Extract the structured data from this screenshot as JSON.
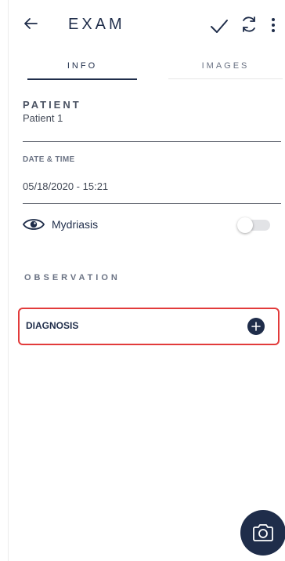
{
  "app_bar": {
    "title": "EXAM",
    "back_icon": "arrow-left-icon",
    "actions": [
      "check-icon",
      "sync-icon",
      "more-vert-icon"
    ]
  },
  "tabs": [
    {
      "label": "INFO",
      "active": true
    },
    {
      "label": "IMAGES",
      "active": false
    }
  ],
  "patient": {
    "label": "PATIENT",
    "value": "Patient 1"
  },
  "date_time": {
    "label": "DATE & TIME",
    "value": "05/18/2020 - 15:21"
  },
  "mydriasis": {
    "label": "Mydriasis",
    "icon": "eye-icon",
    "enabled": false
  },
  "observation": {
    "label": "OBSERVATION"
  },
  "diagnosis": {
    "label": "DIAGNOSIS",
    "add_icon": "plus-circle-icon"
  },
  "fab": {
    "icon": "camera-icon"
  },
  "colors": {
    "primary": "#1f2d4a",
    "highlight": "#e23b3b",
    "muted": "#6b7384"
  }
}
